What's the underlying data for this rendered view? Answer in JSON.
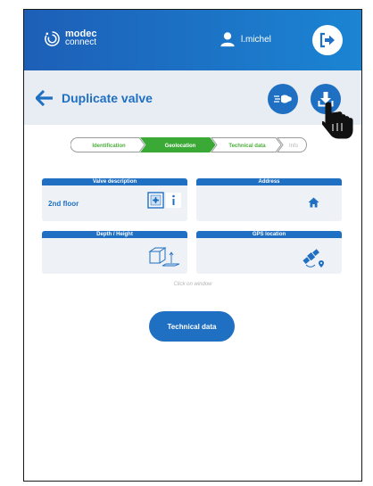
{
  "header": {
    "logo_top": "modec",
    "logo_bottom": "connect",
    "username": "l.michel"
  },
  "page": {
    "title": "Duplicate valve"
  },
  "steps": [
    {
      "label": "Identification",
      "state": "done"
    },
    {
      "label": "Geolocation",
      "state": "active"
    },
    {
      "label": "Technical data",
      "state": "done"
    },
    {
      "label": "Info",
      "state": "pending"
    }
  ],
  "cards": {
    "valve_description": {
      "title": "Valve description",
      "value": "2nd floor"
    },
    "address": {
      "title": "Address"
    },
    "depth_height": {
      "title": "Depth / Height"
    },
    "gps_location": {
      "title": "GPS location"
    }
  },
  "hint": "Click on window",
  "technical_button": "Technical data",
  "colors": {
    "brand_blue": "#1f6fc3",
    "header_gradient_start": "#1d5fb7",
    "header_gradient_end": "#1b84d3",
    "step_done_text": "#4cae3a",
    "step_active_bg": "#3aa935",
    "step_pending_text": "#b5b5b5"
  }
}
